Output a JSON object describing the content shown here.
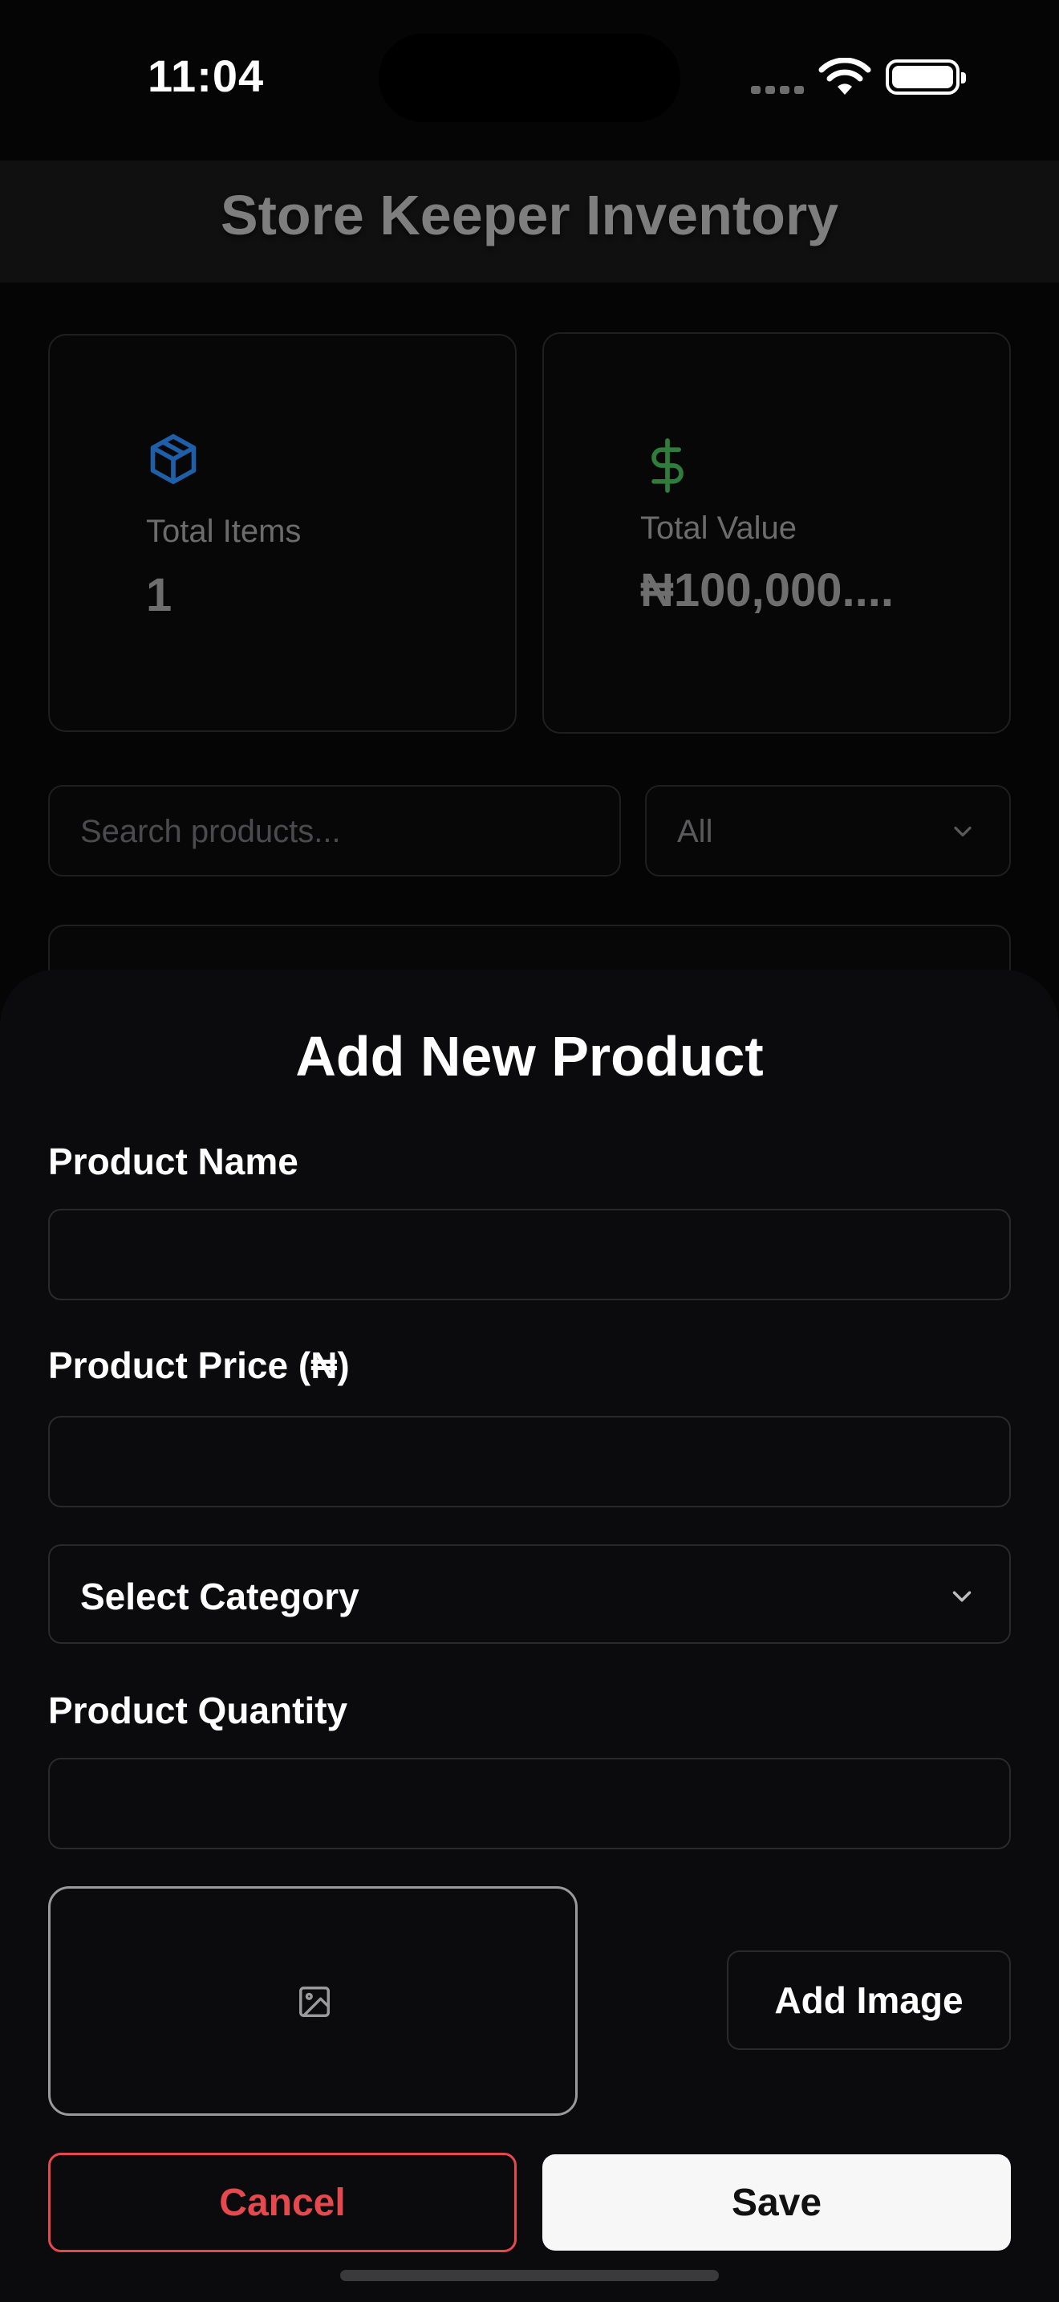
{
  "status_bar": {
    "time": "11:04"
  },
  "header": {
    "title": "Store Keeper Inventory"
  },
  "stats": {
    "total_items": {
      "label": "Total Items",
      "value": "1",
      "icon": "box-icon",
      "icon_color": "#1e5fa8"
    },
    "total_value": {
      "label": "Total Value",
      "value": "₦100,000....",
      "icon": "dollar-icon",
      "icon_color": "#2e7d3a"
    }
  },
  "search": {
    "placeholder": "Search products..."
  },
  "filter": {
    "selected": "All"
  },
  "modal": {
    "title": "Add New Product",
    "product_name_label": "Product Name",
    "product_price_label": "Product Price (₦)",
    "category_placeholder": "Select Category",
    "product_quantity_label": "Product Quantity",
    "add_image_label": "Add Image",
    "cancel_label": "Cancel",
    "save_label": "Save",
    "cancel_color": "#e5484d"
  }
}
